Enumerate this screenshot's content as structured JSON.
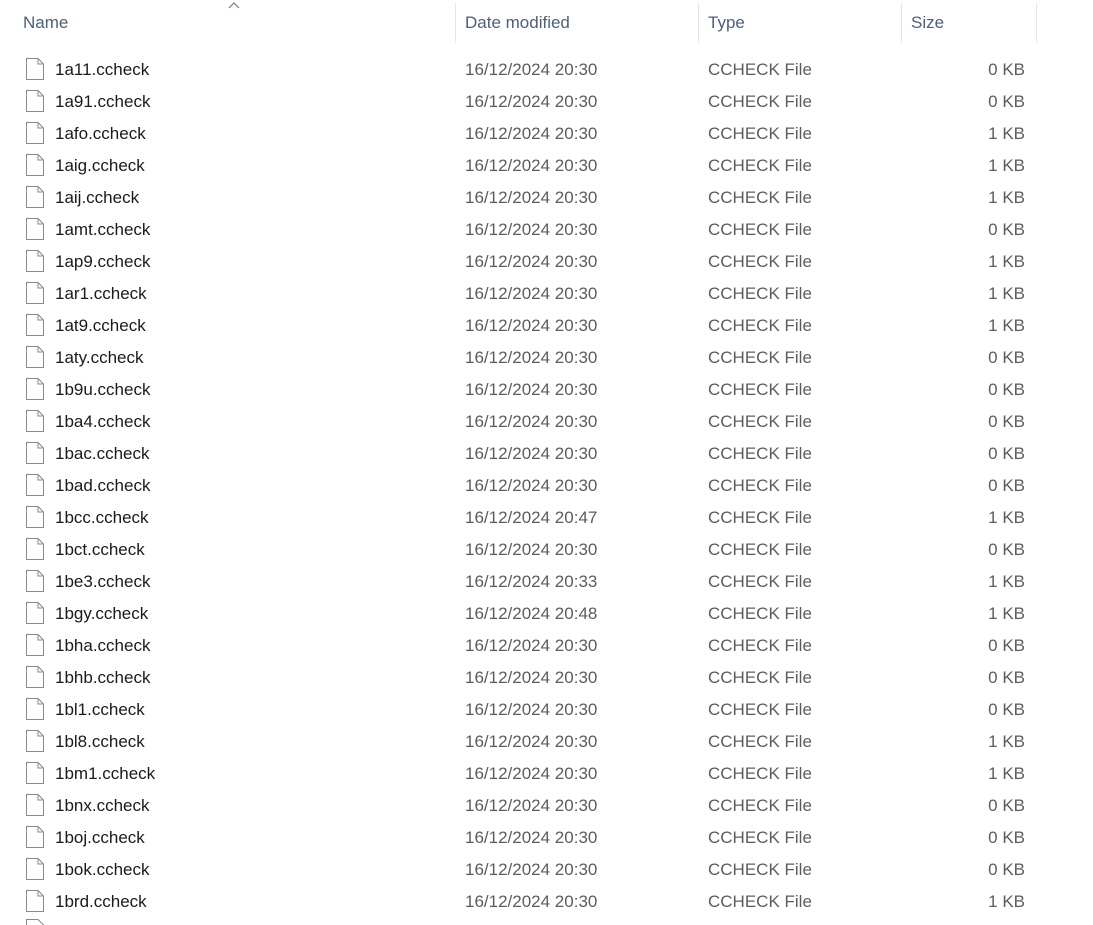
{
  "columns": {
    "name": "Name",
    "date": "Date modified",
    "type": "Type",
    "size": "Size"
  },
  "sort": {
    "column": "name",
    "direction": "ascending",
    "icon": "chevron-up-icon"
  },
  "files": [
    {
      "name": "1a11.ccheck",
      "date": "16/12/2024 20:30",
      "type": "CCHECK File",
      "size": "0 KB"
    },
    {
      "name": "1a91.ccheck",
      "date": "16/12/2024 20:30",
      "type": "CCHECK File",
      "size": "0 KB"
    },
    {
      "name": "1afo.ccheck",
      "date": "16/12/2024 20:30",
      "type": "CCHECK File",
      "size": "1 KB"
    },
    {
      "name": "1aig.ccheck",
      "date": "16/12/2024 20:30",
      "type": "CCHECK File",
      "size": "1 KB"
    },
    {
      "name": "1aij.ccheck",
      "date": "16/12/2024 20:30",
      "type": "CCHECK File",
      "size": "1 KB"
    },
    {
      "name": "1amt.ccheck",
      "date": "16/12/2024 20:30",
      "type": "CCHECK File",
      "size": "0 KB"
    },
    {
      "name": "1ap9.ccheck",
      "date": "16/12/2024 20:30",
      "type": "CCHECK File",
      "size": "1 KB"
    },
    {
      "name": "1ar1.ccheck",
      "date": "16/12/2024 20:30",
      "type": "CCHECK File",
      "size": "1 KB"
    },
    {
      "name": "1at9.ccheck",
      "date": "16/12/2024 20:30",
      "type": "CCHECK File",
      "size": "1 KB"
    },
    {
      "name": "1aty.ccheck",
      "date": "16/12/2024 20:30",
      "type": "CCHECK File",
      "size": "0 KB"
    },
    {
      "name": "1b9u.ccheck",
      "date": "16/12/2024 20:30",
      "type": "CCHECK File",
      "size": "0 KB"
    },
    {
      "name": "1ba4.ccheck",
      "date": "16/12/2024 20:30",
      "type": "CCHECK File",
      "size": "0 KB"
    },
    {
      "name": "1bac.ccheck",
      "date": "16/12/2024 20:30",
      "type": "CCHECK File",
      "size": "0 KB"
    },
    {
      "name": "1bad.ccheck",
      "date": "16/12/2024 20:30",
      "type": "CCHECK File",
      "size": "0 KB"
    },
    {
      "name": "1bcc.ccheck",
      "date": "16/12/2024 20:47",
      "type": "CCHECK File",
      "size": "1 KB"
    },
    {
      "name": "1bct.ccheck",
      "date": "16/12/2024 20:30",
      "type": "CCHECK File",
      "size": "0 KB"
    },
    {
      "name": "1be3.ccheck",
      "date": "16/12/2024 20:33",
      "type": "CCHECK File",
      "size": "1 KB"
    },
    {
      "name": "1bgy.ccheck",
      "date": "16/12/2024 20:48",
      "type": "CCHECK File",
      "size": "1 KB"
    },
    {
      "name": "1bha.ccheck",
      "date": "16/12/2024 20:30",
      "type": "CCHECK File",
      "size": "0 KB"
    },
    {
      "name": "1bhb.ccheck",
      "date": "16/12/2024 20:30",
      "type": "CCHECK File",
      "size": "0 KB"
    },
    {
      "name": "1bl1.ccheck",
      "date": "16/12/2024 20:30",
      "type": "CCHECK File",
      "size": "0 KB"
    },
    {
      "name": "1bl8.ccheck",
      "date": "16/12/2024 20:30",
      "type": "CCHECK File",
      "size": "1 KB"
    },
    {
      "name": "1bm1.ccheck",
      "date": "16/12/2024 20:30",
      "type": "CCHECK File",
      "size": "1 KB"
    },
    {
      "name": "1bnx.ccheck",
      "date": "16/12/2024 20:30",
      "type": "CCHECK File",
      "size": "0 KB"
    },
    {
      "name": "1boj.ccheck",
      "date": "16/12/2024 20:30",
      "type": "CCHECK File",
      "size": "0 KB"
    },
    {
      "name": "1bok.ccheck",
      "date": "16/12/2024 20:30",
      "type": "CCHECK File",
      "size": "0 KB"
    },
    {
      "name": "1brd.ccheck",
      "date": "16/12/2024 20:30",
      "type": "CCHECK File",
      "size": "1 KB"
    }
  ]
}
